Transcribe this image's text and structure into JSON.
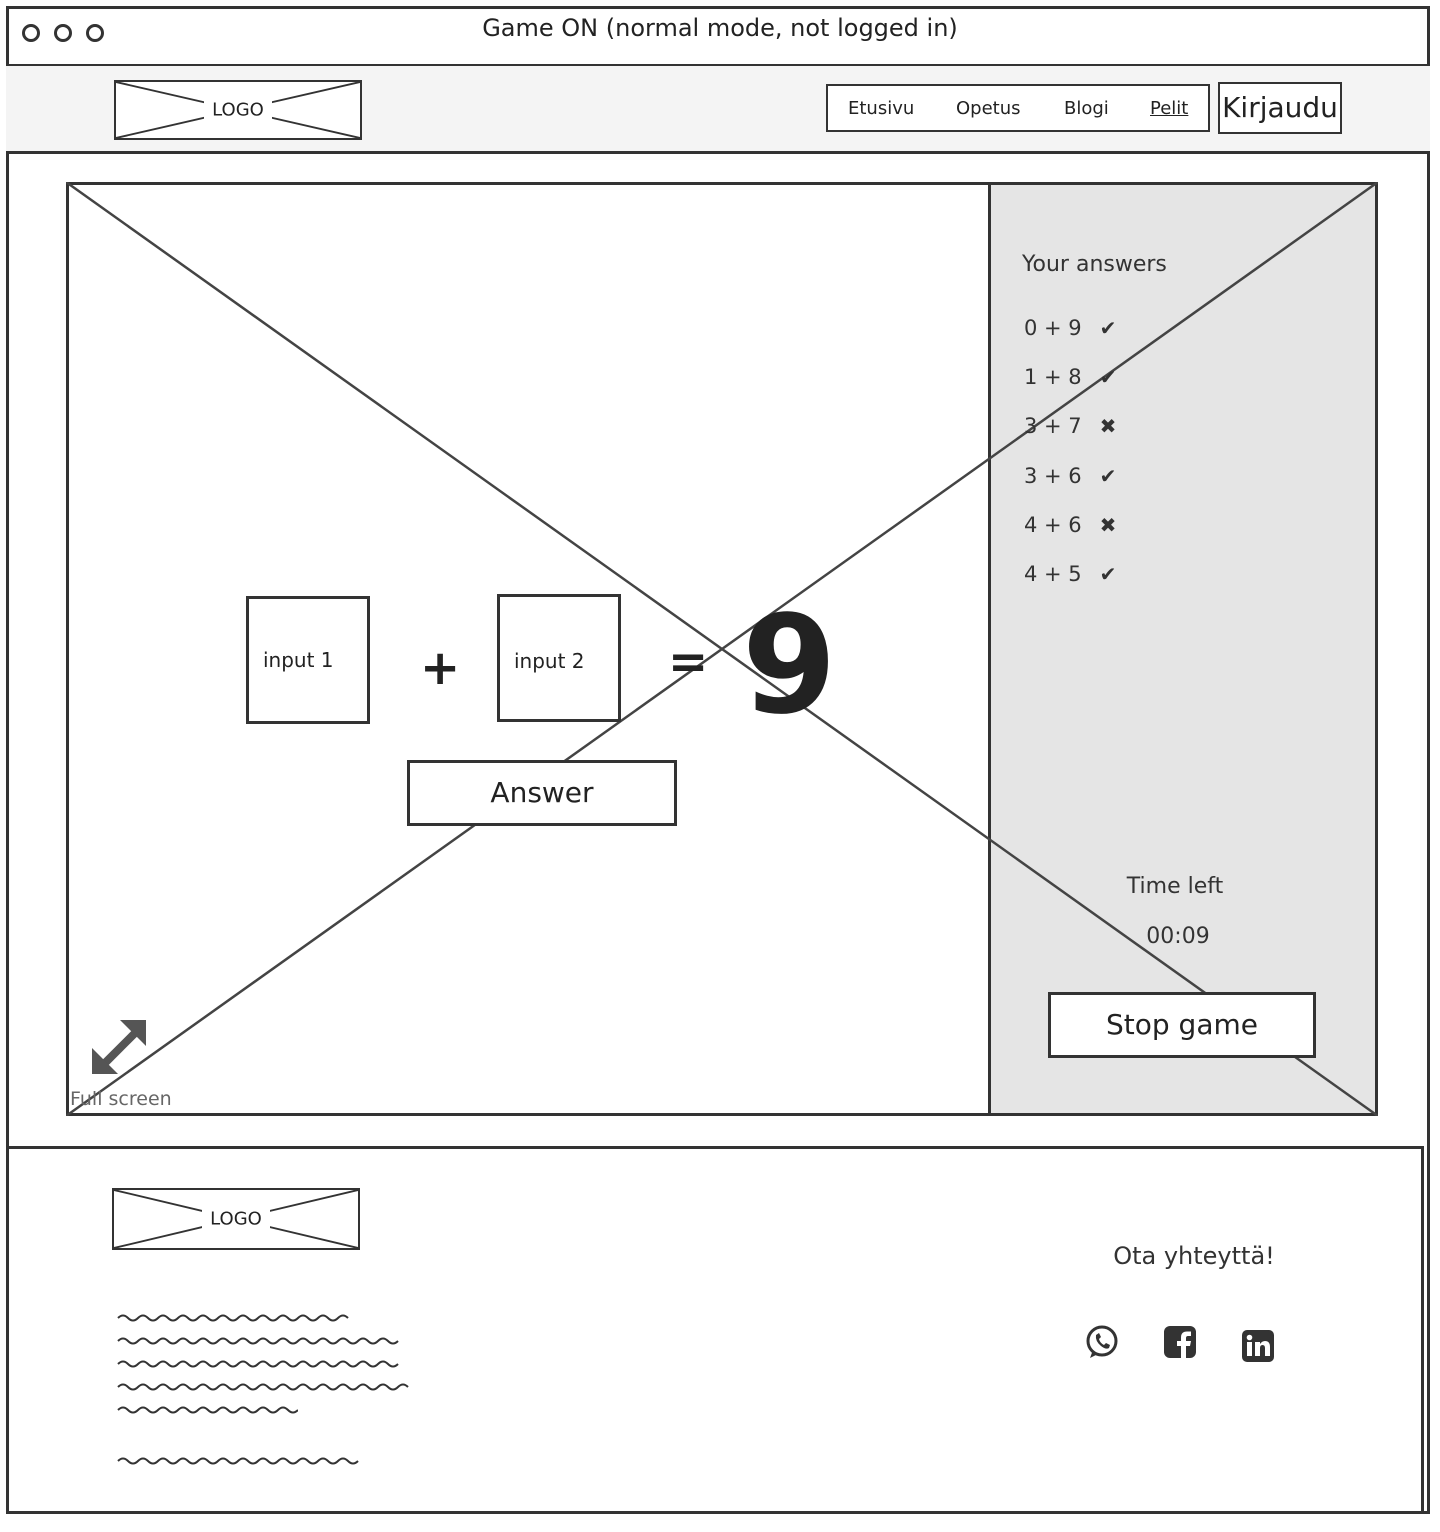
{
  "window": {
    "title": "Game ON (normal mode, not logged in)"
  },
  "header": {
    "logo_label": "LOGO",
    "nav": [
      {
        "label": "Etusivu"
      },
      {
        "label": "Opetus"
      },
      {
        "label": "Blogi"
      },
      {
        "label": "Pelit"
      }
    ],
    "login_label": "Kirjaudu"
  },
  "game": {
    "input1_placeholder": "input 1",
    "input2_placeholder": "input 2",
    "operator": "+",
    "equals": "=",
    "result": "9",
    "answer_label": "Answer",
    "fullscreen_label": "Full screen",
    "icons": {
      "fullscreen": "expand-arrows-icon"
    }
  },
  "sidebar": {
    "title": "Your answers",
    "answers": [
      {
        "expression": "0 + 9",
        "mark": "✔",
        "correct": true
      },
      {
        "expression": "1 + 8",
        "mark": "✔",
        "correct": true
      },
      {
        "expression": "3 + 7",
        "mark": "✖",
        "correct": false
      },
      {
        "expression": "3 + 6",
        "mark": "✔",
        "correct": true
      },
      {
        "expression": "4 + 6",
        "mark": "✖",
        "correct": false
      },
      {
        "expression": "4 + 5",
        "mark": "✔",
        "correct": true
      }
    ],
    "time_left_label": "Time left",
    "time_left_value": "00:09",
    "stop_label": "Stop game"
  },
  "footer": {
    "logo_label": "LOGO",
    "contact_label": "Ota yhteyttä!",
    "social_icons": [
      "whatsapp-icon",
      "facebook-icon",
      "linkedin-icon"
    ]
  },
  "colors": {
    "sidebar_bg": "#e5e5e5",
    "header_bg": "#f4f4f4",
    "ink": "#333333"
  }
}
